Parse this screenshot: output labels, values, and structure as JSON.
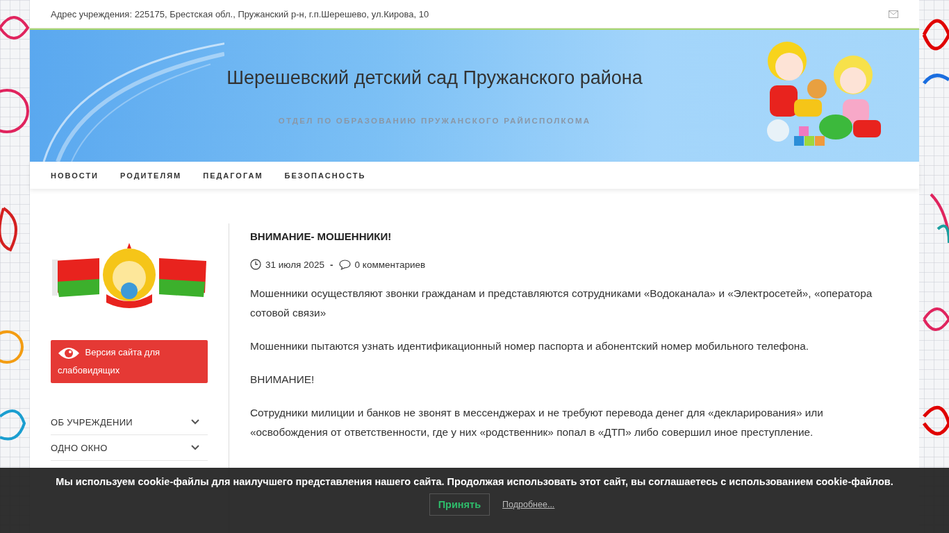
{
  "top_bar": {
    "address": "Адрес учреждения: 225175, Брестская обл., Пружанский р-н, г.п.Шерешево, ул.Кирова, 10"
  },
  "header": {
    "title": "Шерешевский детский сад Пружанского района",
    "subtitle": "ОТДЕЛ ПО ОБРАЗОВАНИЮ ПРУЖАНСКОГО РАЙИСПОЛКОМА"
  },
  "nav": [
    {
      "label": "НОВОСТИ"
    },
    {
      "label": "РОДИТЕЛЯМ"
    },
    {
      "label": "ПЕДАГОГАМ"
    },
    {
      "label": "БЕЗОПАСНОСТЬ"
    }
  ],
  "sidebar": {
    "accessibility_button": "Версия сайта для слабовидящих",
    "items": [
      {
        "label": "ОБ УЧРЕЖДЕНИИ",
        "has_children": true
      },
      {
        "label": "ОДНО ОКНО",
        "has_children": true
      }
    ]
  },
  "article": {
    "title": "ВНИМАНИЕ- МОШЕННИКИ!",
    "date": "31 июля 2025",
    "separator": "-",
    "comments": "0 комментариев",
    "paragraphs": [
      "Мошенники осуществляют звонки гражданам и представляются сотрудниками «Водоканала» и «Электросетей», «оператора сотовой связи»",
      "Мошенники пытаются узнать идентификационный номер паспорта и абонентский номер мобильного телефона.",
      "ВНИМАНИЕ!",
      "Сотрудники милиции и банков не звонят в мессенджерах и не требуют перевода денег для «декларирования» или «освобождения от ответственности, где у них «родственник» попал в «ДТП» либо совершил иное преступление."
    ]
  },
  "cookie_banner": {
    "message": "Мы используем cookie-файлы для наилучшего представления нашего сайта. Продолжая использовать этот сайт, вы соглашаетесь с использованием cookie-файлов.",
    "accept": "Принять",
    "more": "Подробнее..."
  }
}
